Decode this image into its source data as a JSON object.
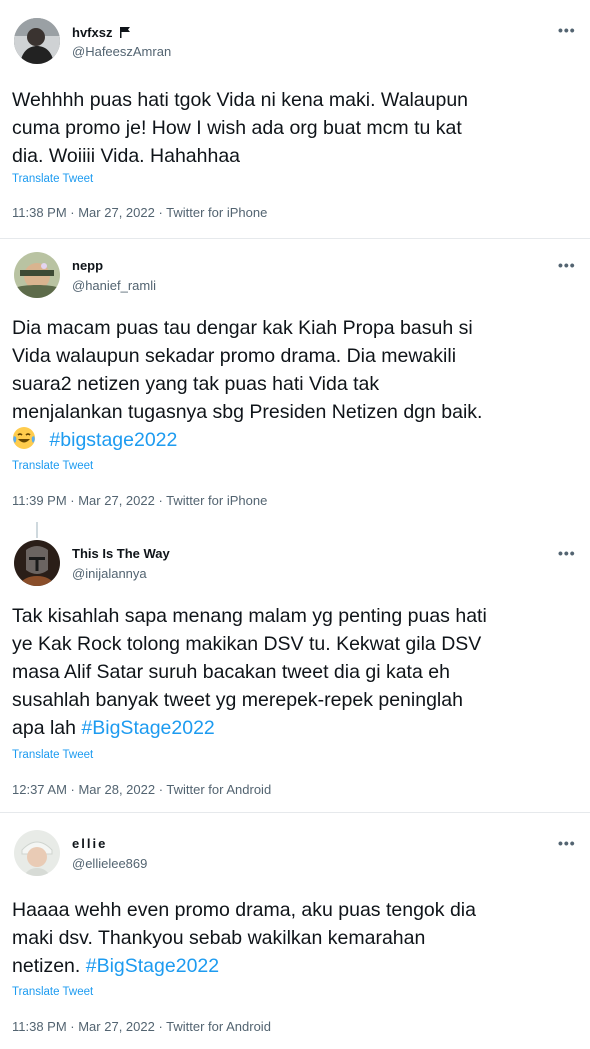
{
  "tweets": [
    {
      "name": "hvfxsz",
      "handle": "@HafeeszAmran",
      "lines": [
        "Wehhhh puas hati tgok Vida ni kena maki. Walaupun",
        "cuma promo je! How I wish ada org buat mcm tu kat",
        "dia. Woiiii Vida. Hahahhaa"
      ],
      "translate": "Translate Tweet",
      "meta": "11:38 PM · Mar 27, 2022 · Twitter for iPhone"
    },
    {
      "name": "nepp",
      "handle": "@hanief_ramli",
      "lines": [
        "Dia macam puas tau dengar kak Kiah Propa basuh si",
        "Vida walaupun sekadar promo drama. Dia mewakili",
        "suara2 netizen yang tak puas hati Vida tak",
        "menjalankan tugasnya sbg Presiden Netizen dgn baik."
      ],
      "hashtag": "#bigstage2022",
      "translate": "Translate Tweet",
      "meta": "11:39 PM · Mar 27, 2022 · Twitter for iPhone"
    },
    {
      "name": "This Is The Way",
      "handle": "@inijalannya",
      "lines": [
        "Tak kisahlah sapa menang malam yg penting puas hati",
        "ye Kak Rock tolong makikan DSV tu. Kekwat gila DSV",
        "masa Alif Satar suruh bacakan tweet dia gi kata eh",
        "susahlah banyak tweet yg merepek-repek peninglah"
      ],
      "last_line": "apa lah",
      "hashtag": "#BigStage2022",
      "translate": "Translate Tweet",
      "meta": "12:37 AM · Mar 28, 2022 · Twitter for Android"
    },
    {
      "name": "ellie",
      "handle": "@ellielee869",
      "lines": [
        "Haaaa wehh even promo drama, aku puas tengok dia",
        "maki dsv.  Thankyou sebab wakilkan kemarahan"
      ],
      "last_line": "netizen.",
      "hashtag": "#BigStage2022",
      "translate": "Translate Tweet",
      "meta": "11:38 PM · Mar 27, 2022 · Twitter for Android"
    }
  ],
  "icons": {
    "more": "more-horizontal-icon",
    "flag": "flag-icon",
    "emoji": "face-with-tears-of-joy-emoji"
  },
  "colors": {
    "link": "#1d9bf0",
    "secondary_text": "#536471",
    "primary_text": "#0f1419",
    "divider": "#e6e9ec"
  }
}
